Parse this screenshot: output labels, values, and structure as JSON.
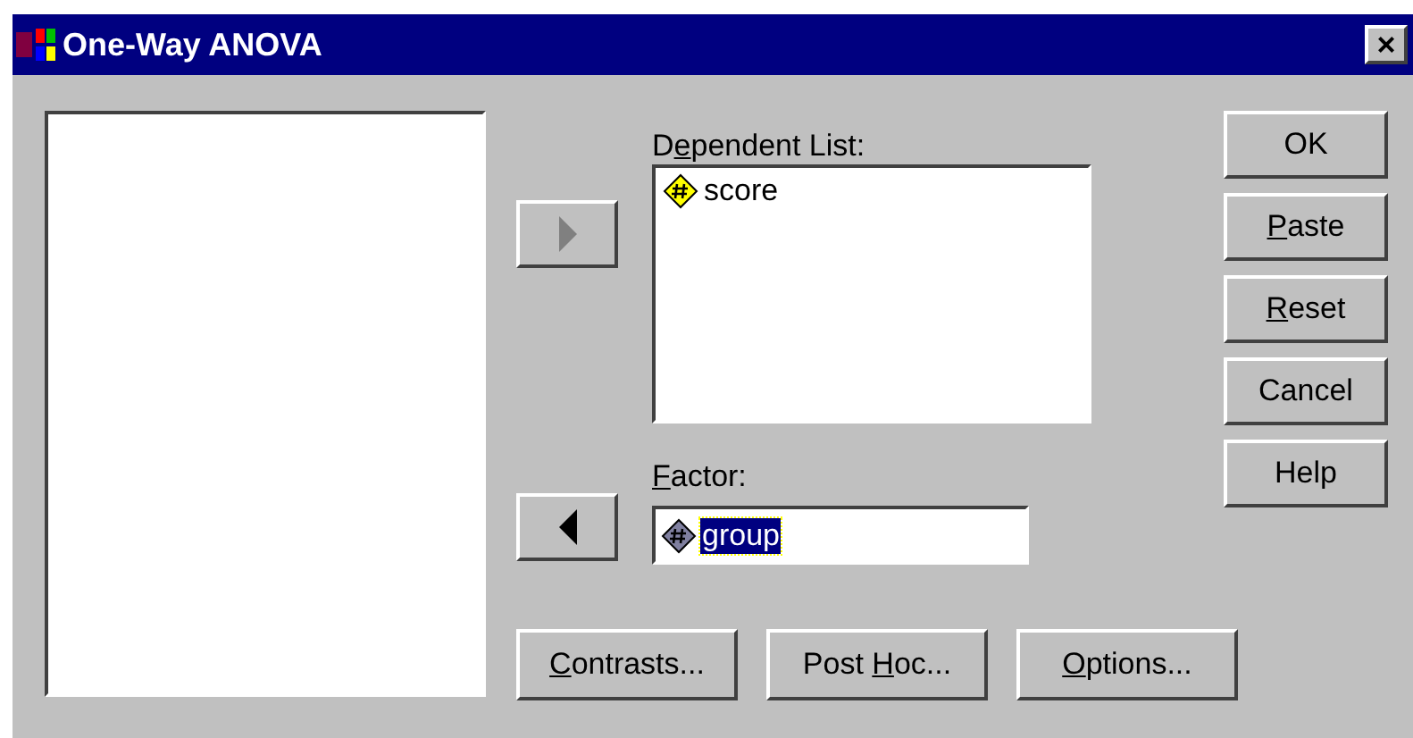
{
  "window": {
    "title": "One-Way ANOVA",
    "close": "×"
  },
  "dependent_list": {
    "label": {
      "pre": "D",
      "key": "e",
      "post": "pendent List:"
    },
    "items": [
      {
        "name": "score",
        "selected": false
      }
    ]
  },
  "move_buttons": [
    {
      "kind": "right",
      "disabled": true
    },
    {
      "kind": "left",
      "disabled": false
    }
  ],
  "factor": {
    "label": {
      "key": "F",
      "post": "actor:"
    },
    "items": [
      {
        "name": "group",
        "selected": true
      }
    ]
  },
  "side_buttons": [
    {
      "pre": "OK"
    },
    {
      "key": "P",
      "post": "aste"
    },
    {
      "key": "R",
      "post": "eset"
    },
    {
      "pre": "Cancel"
    },
    {
      "pre": "Help"
    }
  ],
  "bottom_buttons": [
    {
      "key": "C",
      "post": "ontrasts..."
    },
    {
      "pre": "Post ",
      "key": "H",
      "post": "oc..."
    },
    {
      "key": "O",
      "post": "ptions..."
    }
  ]
}
